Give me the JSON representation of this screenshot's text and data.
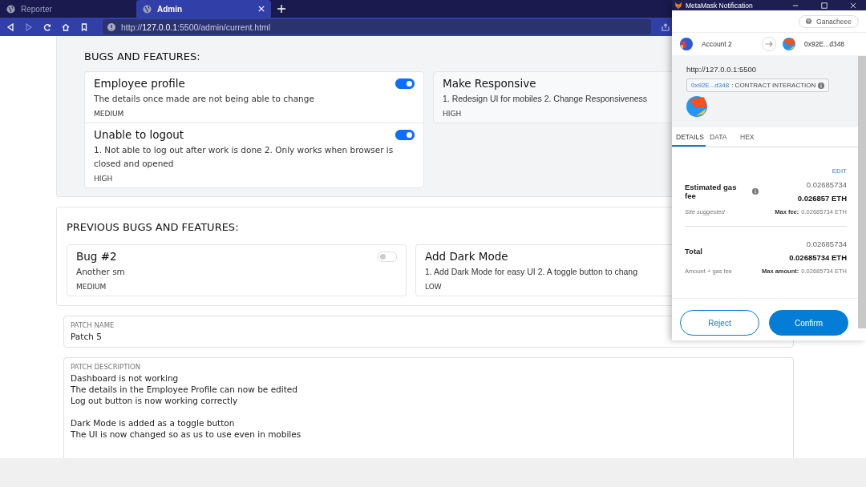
{
  "browser": {
    "tabs": [
      {
        "label": "Reporter",
        "selected": false
      },
      {
        "label": "Admin",
        "selected": true
      }
    ],
    "forward_disabled": true,
    "url": "http://**127.0.0.1**:5500/admin/current.html"
  },
  "sections": [
    {
      "heading": "BUGS AND FEATURES:",
      "shaded": true,
      "columns": [
        [
          {
            "title": "Employee profile",
            "description": "The details once made are not being able to change",
            "priority": "MEDIUM",
            "on": true
          },
          {
            "title": "Unable to logout",
            "description": "1. Not able to log out after work is done 2. Only works when browser is closed and opened",
            "priority": "HIGH",
            "on": true
          }
        ],
        [
          {
            "title": "Make Responsive",
            "description": "1. Redesign UI for mobiles 2. Change Responsiveness",
            "priority": "HIGH"
          }
        ]
      ]
    },
    {
      "heading": "PREVIOUS BUGS AND FEATURES:",
      "shaded": false,
      "columns": [
        [
          {
            "title": "Bug #2",
            "description": "Another sm",
            "priority": "MEDIUM",
            "on": false
          }
        ],
        [
          {
            "title": "Add Dark Mode",
            "description": "1. Add Dark Mode for easy UI 2. A toggle button to chang",
            "priority": "LOW"
          }
        ]
      ]
    }
  ],
  "patch_name": {
    "label": "PATCH NAME",
    "value": "Patch 5"
  },
  "patch_description": {
    "label": "PATCH DESCRIPTION",
    "value": "Dashboard is not working\nThe details in the Employee Profile can now be edited\nLog out button is now working correctly\n\nDark Mode is added as a toggle button\nThe UI is now changed so as us to use even in mobiles"
  },
  "metamask": {
    "title": "MetaMask Notification",
    "network": "Ganacheee",
    "from_account": "Account 2",
    "to_account": "0x92E...d348",
    "origin": "http://127.0.0.1:5500",
    "contract_address": "0x92E...d348",
    "contract_label": ": CONTRACT INTERACTION",
    "tabs": [
      {
        "label": "DETAILS",
        "selected": true
      },
      {
        "label": "DATA",
        "selected": false
      },
      {
        "label": "HEX",
        "selected": false
      }
    ],
    "edit": "EDIT",
    "rows": [
      {
        "label": "Estimated gas fee",
        "has_info": true,
        "secondary": "0.02685734",
        "primary": "0.026857 ETH",
        "note": "Site suggested",
        "max_label": "Max fee:",
        "max_value": "0.02685734 ETH"
      },
      {
        "label": "Total",
        "has_info": false,
        "secondary": "0.02685734",
        "primary": "0.02685734 ETH",
        "note": "Amount + gas fee",
        "max_label": "Max amount:",
        "max_value": "0.02685734 ETH"
      }
    ],
    "buttons": [
      {
        "label": "Reject",
        "kind": "secondary"
      },
      {
        "label": "Confirm",
        "kind": "primary"
      }
    ]
  }
}
